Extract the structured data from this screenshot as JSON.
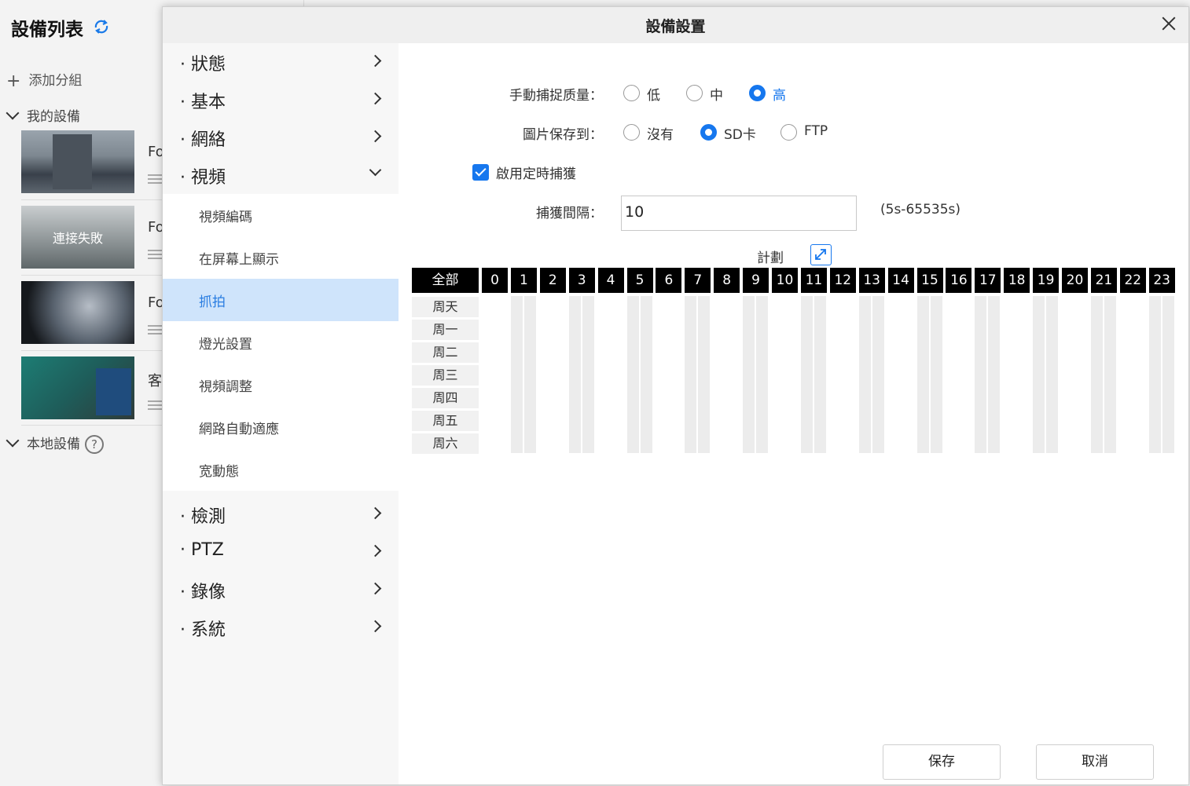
{
  "bg": {
    "title": "設備列表",
    "add_group": "添加分組",
    "my_devices": "我的設備",
    "local_devices": "本地設備",
    "cameras": [
      {
        "label": "Fo",
        "overlay": ""
      },
      {
        "label": "Fo",
        "overlay": "連接失敗"
      },
      {
        "label": "Fo",
        "overlay": ""
      },
      {
        "label": "客",
        "overlay": ""
      }
    ]
  },
  "dialog": {
    "title": "設備設置",
    "menu": [
      {
        "label": "· 狀態"
      },
      {
        "label": "· 基本"
      },
      {
        "label": "· 網絡"
      },
      {
        "label": "· 視頻"
      }
    ],
    "submenu": [
      {
        "label": "視頻編碼"
      },
      {
        "label": "在屏幕上顯示"
      },
      {
        "label": "抓拍"
      },
      {
        "label": "燈光設置"
      },
      {
        "label": "視頻調整"
      },
      {
        "label": "網路自動適應"
      },
      {
        "label": "宽動態"
      }
    ],
    "menu_after": [
      {
        "label": "· 檢測"
      },
      {
        "label": "· PTZ"
      },
      {
        "label": "· 錄像"
      },
      {
        "label": "· 系統"
      }
    ],
    "form": {
      "quality_label": "手動捕捉质量：",
      "quality_options": [
        "低",
        "中",
        "高"
      ],
      "quality_selected": "高",
      "save_label": "圖片保存到：",
      "save_options": [
        "沒有",
        "SD卡",
        "FTP"
      ],
      "save_selected": "SD卡",
      "timed_capture_label": "啟用定時捕獲",
      "timed_capture_checked": true,
      "interval_label": "捕獲間隔：",
      "interval_value": "10",
      "interval_range": "(5s-65535s)",
      "plan_label": "計劃"
    },
    "schedule": {
      "all_label": "全部",
      "hours": [
        "0",
        "1",
        "2",
        "3",
        "4",
        "5",
        "6",
        "7",
        "8",
        "9",
        "10",
        "11",
        "12",
        "13",
        "14",
        "15",
        "16",
        "17",
        "18",
        "19",
        "20",
        "21",
        "22",
        "23"
      ],
      "days": [
        "周天",
        "周一",
        "周二",
        "周三",
        "周四",
        "周五",
        "周六"
      ]
    },
    "buttons": {
      "save": "保存",
      "cancel": "取消"
    },
    "colors": {
      "accent": "#1677ee",
      "active_bg": "#cfe4fb",
      "header_black": "#000000"
    }
  }
}
